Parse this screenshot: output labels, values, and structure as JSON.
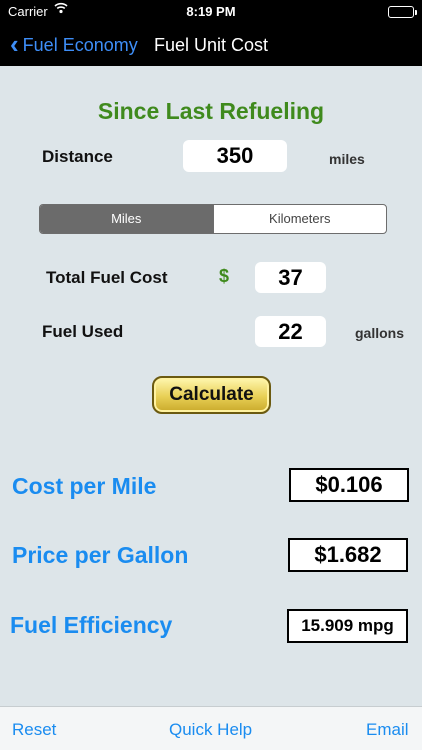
{
  "status": {
    "carrier": "Carrier",
    "wifi_icon": "wifi-icon",
    "time": "8:19 PM",
    "battery_icon": "battery-icon",
    "battery_level": 1.0
  },
  "nav": {
    "back_label": "Fuel Economy",
    "title": "Fuel Unit Cost"
  },
  "form": {
    "section_title": "Since Last Refueling",
    "distance_label": "Distance",
    "distance_value": "350",
    "distance_unit": "miles",
    "units_segments": [
      "Miles",
      "Kilometers"
    ],
    "units_selected": "Miles",
    "total_fuel_cost_label": "Total Fuel Cost",
    "currency_symbol": "$",
    "total_fuel_cost_value": "37",
    "fuel_used_label": "Fuel Used",
    "fuel_used_value": "22",
    "fuel_used_unit": "gallons",
    "calculate_label": "Calculate"
  },
  "results": {
    "cost_per_mile_label": "Cost per Mile",
    "cost_per_mile_value": "$0.106",
    "price_per_gallon_label": "Price per Gallon",
    "price_per_gallon_value": "$1.682",
    "fuel_efficiency_label": "Fuel Efficiency",
    "fuel_efficiency_value": "15.909 mpg"
  },
  "toolbar": {
    "reset_label": "Reset",
    "quick_help_label": "Quick Help",
    "email_label": "Email"
  },
  "colors": {
    "accent_blue": "#1a8cf0",
    "nav_blue": "#3e8ef7",
    "section_green": "#3f8a1d",
    "background": "#dde5e9"
  }
}
